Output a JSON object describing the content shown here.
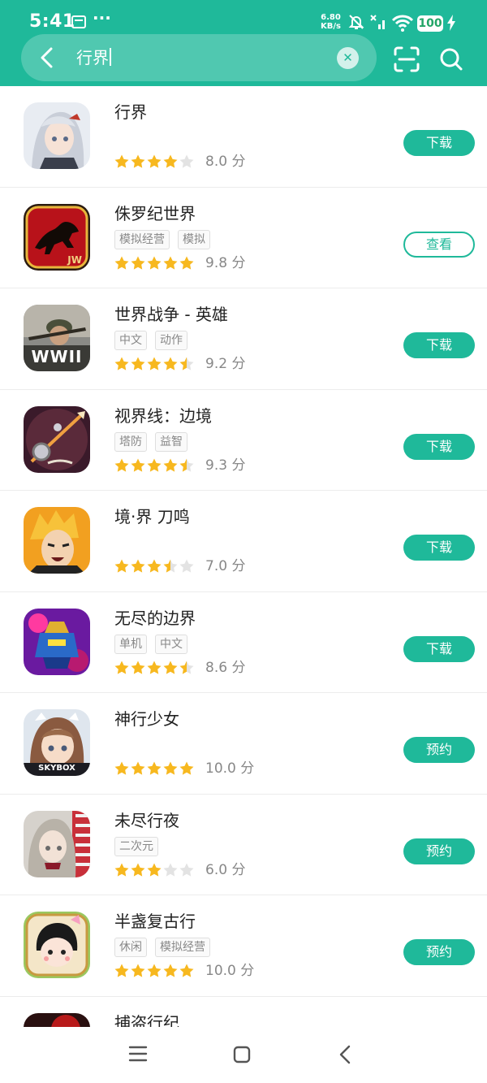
{
  "status": {
    "time": "5:41",
    "dots": "···",
    "speed_value": "6.80",
    "speed_unit": "KB/s",
    "battery": "100"
  },
  "search": {
    "query": "行界"
  },
  "colors": {
    "accent": "#1fb99a",
    "star": "#f7b81f",
    "star_empty": "#e3e3e3"
  },
  "apps": [
    {
      "name": "行界",
      "tags": [],
      "rating": 4,
      "score": "8.0 分",
      "action": "下载",
      "style": "filled"
    },
    {
      "name": "侏罗纪世界",
      "tags": [
        "模拟经营",
        "模拟"
      ],
      "rating": 5,
      "score": "9.8 分",
      "action": "查看",
      "style": "outline",
      "icon_text": "JW"
    },
    {
      "name": "世界战争 - 英雄",
      "tags": [
        "中文",
        "动作"
      ],
      "rating": 4.5,
      "score": "9.2 分",
      "action": "下载",
      "style": "filled",
      "icon_text": "WWII"
    },
    {
      "name": "视界线：边境",
      "tags": [
        "塔防",
        "益智"
      ],
      "rating": 4.5,
      "score": "9.3 分",
      "action": "下载",
      "style": "filled"
    },
    {
      "name": "境·界 刀鸣",
      "tags": [],
      "rating": 3.5,
      "score": "7.0 分",
      "action": "下载",
      "style": "filled"
    },
    {
      "name": "无尽的边界",
      "tags": [
        "单机",
        "中文"
      ],
      "rating": 4.5,
      "score": "8.6 分",
      "action": "下载",
      "style": "filled"
    },
    {
      "name": "神行少女",
      "tags": [],
      "rating": 5,
      "score": "10.0 分",
      "action": "预约",
      "style": "filled",
      "icon_text": "SKYBOX"
    },
    {
      "name": "未尽行夜",
      "tags": [
        "二次元"
      ],
      "rating": 3,
      "score": "6.0 分",
      "action": "预约",
      "style": "filled"
    },
    {
      "name": "半盏复古行",
      "tags": [
        "休闲",
        "模拟经营"
      ],
      "rating": 5,
      "score": "10.0 分",
      "action": "预约",
      "style": "filled"
    },
    {
      "name": "捕盗行纪",
      "tags": [],
      "rating": 0,
      "score": "",
      "action": "",
      "style": "none"
    }
  ]
}
